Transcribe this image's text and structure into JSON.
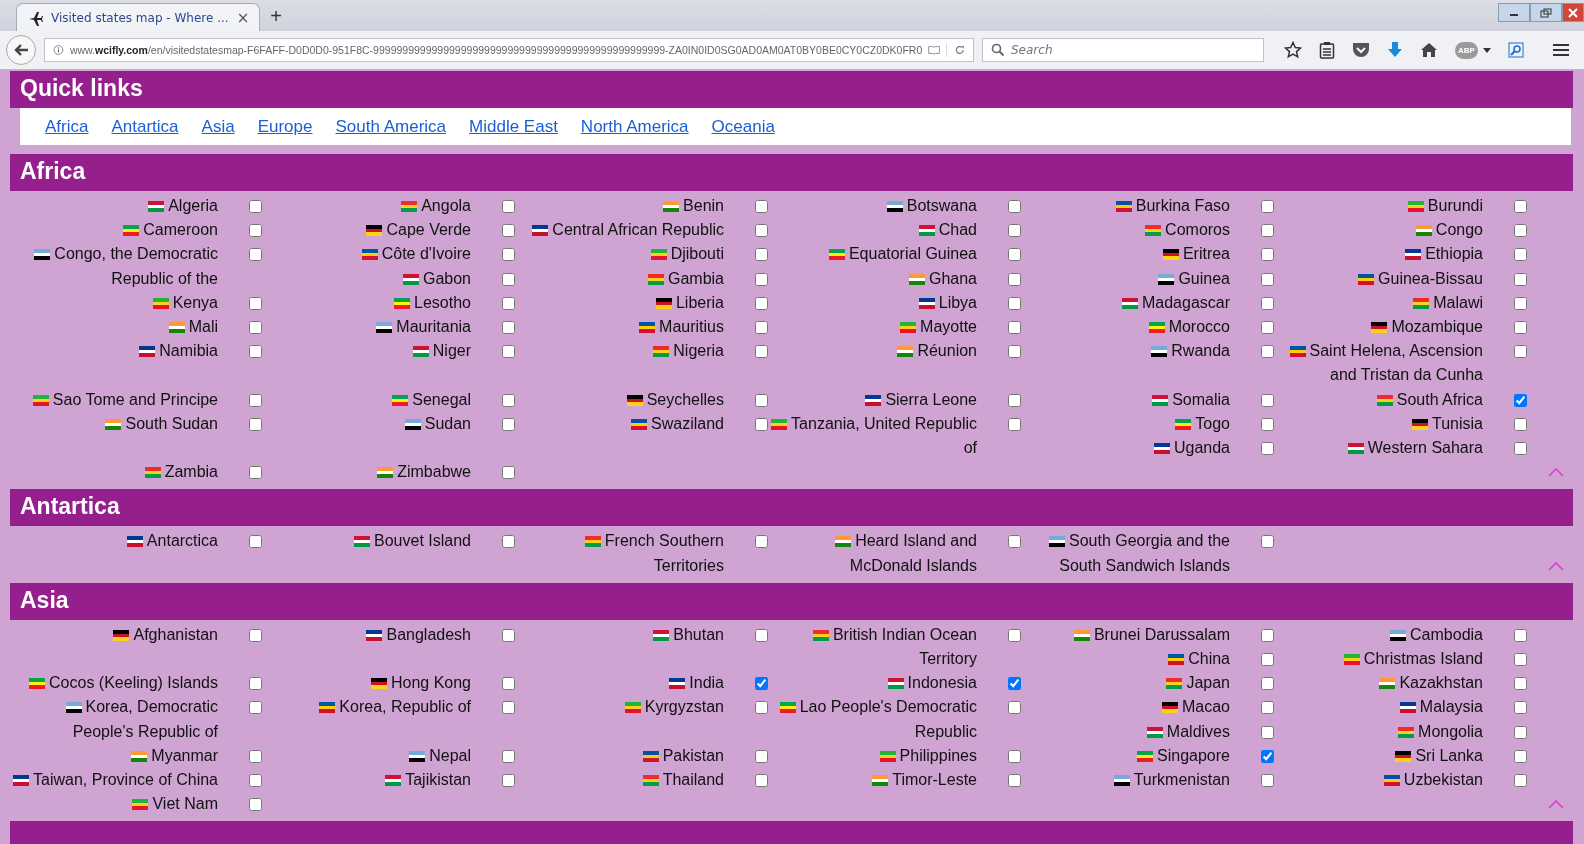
{
  "browser": {
    "tab": {
      "title": "Visited states map - Where ...",
      "close": "×",
      "selected": true
    },
    "new_tab": "+",
    "url": {
      "prefix": "www.",
      "domain": "wcifly.com",
      "path": "/en/visitedstatesmap-F6FAFF-D0D0D0-951F8C-99999999999999999999999999999999999999999999999999-ZA0IN0ID0SG0AD0AM0AT0BY0BE0CY0CZ0DK0FR0"
    },
    "search": {
      "placeholder": "Search"
    },
    "abp": "ABP"
  },
  "quick_links": {
    "title": "Quick links",
    "links": [
      "Africa",
      "Antartica",
      "Asia",
      "Europe",
      "South America",
      "Middle East",
      "North America",
      "Oceania"
    ]
  },
  "sections": [
    {
      "title": "Africa",
      "countries": [
        {
          "name": "Algeria",
          "checked": false
        },
        {
          "name": "Angola",
          "checked": false
        },
        {
          "name": "Benin",
          "checked": false
        },
        {
          "name": "Botswana",
          "checked": false
        },
        {
          "name": "Burkina Faso",
          "checked": false
        },
        {
          "name": "Burundi",
          "checked": false
        },
        {
          "name": "Cameroon",
          "checked": false
        },
        {
          "name": "Cape Verde",
          "checked": false
        },
        {
          "name": "Central African Republic",
          "checked": false
        },
        {
          "name": "Chad",
          "checked": false
        },
        {
          "name": "Comoros",
          "checked": false
        },
        {
          "name": "Congo",
          "checked": false
        },
        {
          "name": "Congo, the Democratic Republic of the",
          "checked": false
        },
        {
          "name": "Côte d'Ivoire",
          "checked": false
        },
        {
          "name": "Djibouti",
          "checked": false
        },
        {
          "name": "Equatorial Guinea",
          "checked": false
        },
        {
          "name": "Eritrea",
          "checked": false
        },
        {
          "name": "Ethiopia",
          "checked": false
        },
        {
          "name": "Gabon",
          "checked": false
        },
        {
          "name": "Gambia",
          "checked": false
        },
        {
          "name": "Ghana",
          "checked": false
        },
        {
          "name": "Guinea",
          "checked": false
        },
        {
          "name": "Guinea-Bissau",
          "checked": false
        },
        {
          "name": "Kenya",
          "checked": false
        },
        {
          "name": "Lesotho",
          "checked": false
        },
        {
          "name": "Liberia",
          "checked": false
        },
        {
          "name": "Libya",
          "checked": false
        },
        {
          "name": "Madagascar",
          "checked": false
        },
        {
          "name": "Malawi",
          "checked": false
        },
        {
          "name": "Mali",
          "checked": false
        },
        {
          "name": "Mauritania",
          "checked": false
        },
        {
          "name": "Mauritius",
          "checked": false
        },
        {
          "name": "Mayotte",
          "checked": false
        },
        {
          "name": "Morocco",
          "checked": false
        },
        {
          "name": "Mozambique",
          "checked": false
        },
        {
          "name": "Namibia",
          "checked": false
        },
        {
          "name": "Niger",
          "checked": false
        },
        {
          "name": "Nigeria",
          "checked": false
        },
        {
          "name": "Réunion",
          "checked": false
        },
        {
          "name": "Rwanda",
          "checked": false
        },
        {
          "name": "Saint Helena, Ascension and Tristan da Cunha",
          "checked": false
        },
        {
          "name": "Sao Tome and Principe",
          "checked": false
        },
        {
          "name": "Senegal",
          "checked": false
        },
        {
          "name": "Seychelles",
          "checked": false
        },
        {
          "name": "Sierra Leone",
          "checked": false
        },
        {
          "name": "Somalia",
          "checked": false
        },
        {
          "name": "South Africa",
          "checked": true
        },
        {
          "name": "South Sudan",
          "checked": false
        },
        {
          "name": "Sudan",
          "checked": false
        },
        {
          "name": "Swaziland",
          "checked": false
        },
        {
          "name": "Tanzania, United Republic of",
          "checked": false
        },
        {
          "name": "Togo",
          "checked": false
        },
        {
          "name": "Tunisia",
          "checked": false
        },
        {
          "name": "Uganda",
          "checked": false
        },
        {
          "name": "Western Sahara",
          "checked": false
        },
        {
          "name": "Zambia",
          "checked": false
        },
        {
          "name": "Zimbabwe",
          "checked": false
        }
      ]
    },
    {
      "title": "Antartica",
      "countries": [
        {
          "name": "Antarctica",
          "checked": false
        },
        {
          "name": "Bouvet Island",
          "checked": false
        },
        {
          "name": "French Southern Territories",
          "checked": false
        },
        {
          "name": "Heard Island and McDonald Islands",
          "checked": false
        },
        {
          "name": "South Georgia and the South Sandwich Islands",
          "checked": false
        }
      ]
    },
    {
      "title": "Asia",
      "countries": [
        {
          "name": "Afghanistan",
          "checked": false
        },
        {
          "name": "Bangladesh",
          "checked": false
        },
        {
          "name": "Bhutan",
          "checked": false
        },
        {
          "name": "British Indian Ocean Territory",
          "checked": false
        },
        {
          "name": "Brunei Darussalam",
          "checked": false
        },
        {
          "name": "Cambodia",
          "checked": false
        },
        {
          "name": "China",
          "checked": false
        },
        {
          "name": "Christmas Island",
          "checked": false
        },
        {
          "name": "Cocos (Keeling) Islands",
          "checked": false
        },
        {
          "name": "Hong Kong",
          "checked": false
        },
        {
          "name": "India",
          "checked": true
        },
        {
          "name": "Indonesia",
          "checked": true
        },
        {
          "name": "Japan",
          "checked": false
        },
        {
          "name": "Kazakhstan",
          "checked": false
        },
        {
          "name": "Korea, Democratic People's Republic of",
          "checked": false
        },
        {
          "name": "Korea, Republic of",
          "checked": false
        },
        {
          "name": "Kyrgyzstan",
          "checked": false
        },
        {
          "name": "Lao People's Democratic Republic",
          "checked": false
        },
        {
          "name": "Macao",
          "checked": false
        },
        {
          "name": "Malaysia",
          "checked": false
        },
        {
          "name": "Maldives",
          "checked": false
        },
        {
          "name": "Mongolia",
          "checked": false
        },
        {
          "name": "Myanmar",
          "checked": false
        },
        {
          "name": "Nepal",
          "checked": false
        },
        {
          "name": "Pakistan",
          "checked": false
        },
        {
          "name": "Philippines",
          "checked": false
        },
        {
          "name": "Singapore",
          "checked": true
        },
        {
          "name": "Sri Lanka",
          "checked": false
        },
        {
          "name": "Taiwan, Province of China",
          "checked": false
        },
        {
          "name": "Tajikistan",
          "checked": false
        },
        {
          "name": "Thailand",
          "checked": false
        },
        {
          "name": "Timor-Leste",
          "checked": false
        },
        {
          "name": "Turkmenistan",
          "checked": false
        },
        {
          "name": "Uzbekistan",
          "checked": false
        },
        {
          "name": "Viet Nam",
          "checked": false
        }
      ]
    }
  ]
}
